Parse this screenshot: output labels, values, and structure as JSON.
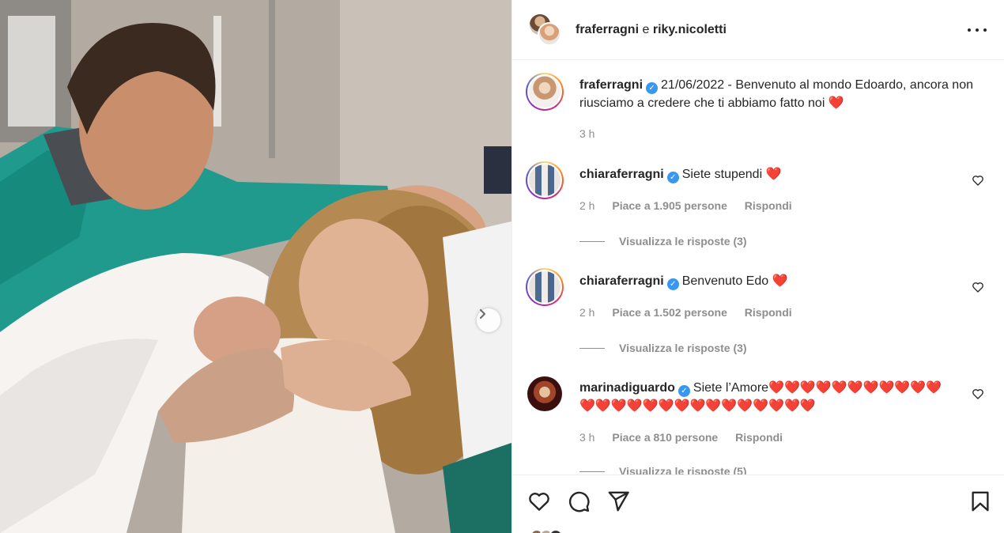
{
  "header": {
    "user1": "fraferragni",
    "conjunction": "e",
    "user2": "riky.nicoletti"
  },
  "caption": {
    "username": "fraferragni",
    "text": "21/06/2022 - Benvenuto al mondo Edoardo, ancora non riusciamo a credere che ti abbiamo fatto noi ❤️",
    "time": "3 h"
  },
  "comments": [
    {
      "username": "chiaraferragni",
      "text": "Siete stupendi ❤️",
      "time": "2 h",
      "likes": "Piace a 1.905 persone",
      "reply": "Rispondi",
      "view_replies": "Visualizza le risposte (3)"
    },
    {
      "username": "chiaraferragni",
      "text": "Benvenuto Edo ❤️",
      "time": "2 h",
      "likes": "Piace a 1.502 persone",
      "reply": "Rispondi",
      "view_replies": "Visualizza le risposte (3)"
    },
    {
      "username": "marinadiguardo",
      "text": "Siete l’Amore❤️❤️❤️❤️❤️❤️❤️❤️❤️❤️❤️❤️❤️❤️❤️❤️❤️❤️❤️❤️❤️❤️❤️❤️❤️❤️",
      "time": "3 h",
      "likes": "Piace a 810 persone",
      "reply": "Rispondi",
      "view_replies": "Visualizza le risposte (5)"
    }
  ],
  "icons": {
    "more": "more-horizontal-icon",
    "verified": "verified-badge-icon",
    "like": "heart-icon",
    "comment": "comment-icon",
    "share": "paper-plane-icon",
    "save": "bookmark-icon",
    "next": "chevron-right-icon"
  },
  "colors": {
    "text": "#262626",
    "secondary": "#8e8e8e",
    "verified": "#3897f0",
    "heart": "#e0245e"
  }
}
